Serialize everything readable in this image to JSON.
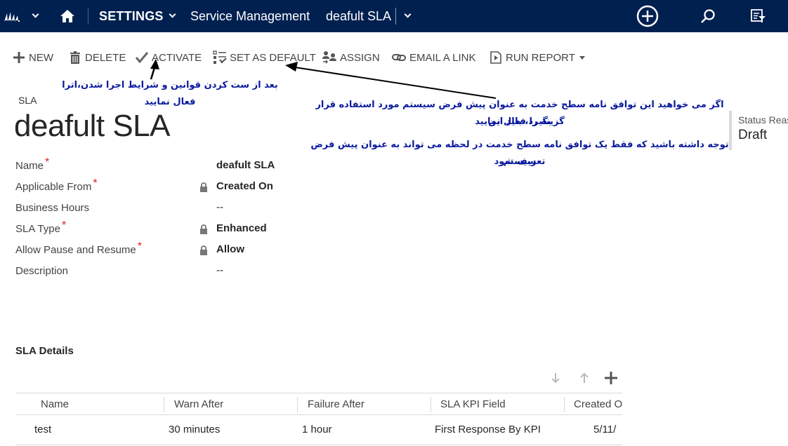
{
  "nav": {
    "logo_icon": "dynamics-logo-icon",
    "home_icon": "home-icon",
    "settings_label": "SETTINGS",
    "area_label": "Service Management",
    "record_label": "deafult SLA",
    "create_icon": "plus-circle-icon",
    "search_icon": "search-icon",
    "advanced_find_icon": "advanced-find-icon"
  },
  "commands": [
    {
      "label": "NEW",
      "icon": "plus-icon"
    },
    {
      "label": "DELETE",
      "icon": "trash-icon"
    },
    {
      "label": "ACTIVATE",
      "icon": "checkmark-icon"
    },
    {
      "label": "SET AS DEFAULT",
      "icon": "set-default-icon"
    },
    {
      "label": "ASSIGN",
      "icon": "assign-users-icon"
    },
    {
      "label": "EMAIL A LINK",
      "icon": "link-icon"
    },
    {
      "label": "RUN REPORT",
      "icon": "report-icon"
    }
  ],
  "annotations": {
    "activate_note": "بعد از ست کردن قوانین و شرایط اجرا شدن،اترا  فعال نمایید",
    "default_note_line1": "اگر می خواهید این توافق نامه سطح خدمت به عنوان پیش فرض سیستم مورد استفاده قرار بگیرد، باید این",
    "default_note_line2": "گزینه را فعال نمایید",
    "warning_line1": "توجه داشته باشید که فقط یک توافق نامه سطح خدمت در لحظه می تواند به عنوان پیش فرض سیستم",
    "warning_line2": "تعریف شود"
  },
  "header": {
    "entity_type": "SLA",
    "title": "deafult SLA",
    "status_label": "Status Reason",
    "status_value": "Draft"
  },
  "fields": [
    {
      "label": "Name",
      "required": true,
      "locked": false,
      "value": "deafult SLA"
    },
    {
      "label": "Applicable From",
      "required": true,
      "locked": true,
      "value": "Created On"
    },
    {
      "label": "Business Hours",
      "required": false,
      "locked": false,
      "value": "--"
    },
    {
      "label": "SLA Type",
      "required": true,
      "locked": true,
      "value": "Enhanced"
    },
    {
      "label": "Allow Pause and Resume",
      "required": true,
      "locked": true,
      "value": "Allow"
    },
    {
      "label": "Description",
      "required": false,
      "locked": false,
      "value": "--"
    }
  ],
  "required_marker": "*",
  "sla_details": {
    "title": "SLA Details",
    "columns": [
      "Name",
      "Warn After",
      "Failure After",
      "SLA KPI Field",
      "Created On"
    ],
    "rows": [
      [
        "test",
        "30 minutes",
        "1 hour",
        "First Response By KPI",
        "5/11/"
      ]
    ]
  }
}
